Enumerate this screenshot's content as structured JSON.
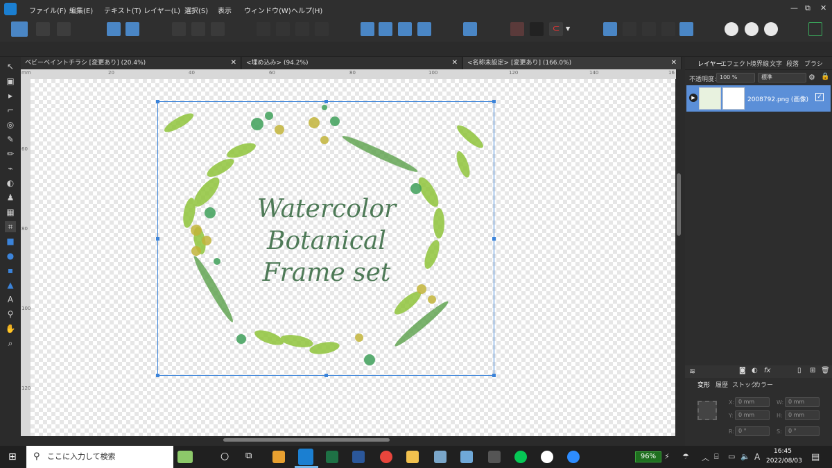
{
  "menu": {
    "items": [
      "ファイル(F)",
      "編集(E)",
      "テキスト(T)",
      "レイヤー(L)",
      "選択(S)",
      "表示",
      "ウィンドウ(W)",
      "ヘルプ(H)"
    ],
    "window_controls": [
      "—",
      "⧉",
      "✕"
    ]
  },
  "tabs": [
    {
      "label": "ベビーベイントチラシ [変更あり] (20.4%)",
      "close": "✕"
    },
    {
      "label": "<埋め込み> (94.2%)",
      "close": "✕"
    },
    {
      "label": "<名称未設定> [変更あり] (166.0%)",
      "close": "✕"
    }
  ],
  "ruler": {
    "unit": "mm",
    "h_ticks": [
      "20",
      "40",
      "60",
      "80",
      "100",
      "120",
      "140",
      "16"
    ],
    "v_ticks": [
      "60",
      "80",
      "100",
      "120"
    ]
  },
  "artwork": {
    "lines": [
      "Watercolor",
      "Botanical",
      "Frame set"
    ]
  },
  "layers_panel": {
    "tabs": [
      "レイヤー",
      "エフェクト",
      "境界線",
      "文字",
      "段落",
      "ブラシ"
    ],
    "opacity_label": "不透明度:",
    "opacity_value": "100 %",
    "blend_mode": "標準",
    "layer_name": "2008792.png (画像)"
  },
  "transform_panel": {
    "tabs": [
      "変形",
      "履歴",
      "ストック",
      "カラー"
    ],
    "x_label": "X:",
    "x_value": "0 mm",
    "y_label": "Y:",
    "y_value": "0 mm",
    "w_label": "W:",
    "w_value": "0 mm",
    "h_label": "H:",
    "h_value": "0 mm",
    "r_label": "R:",
    "r_value": "0 °",
    "s_label": "S:",
    "s_value": "0 °"
  },
  "taskbar": {
    "search_placeholder": "ここに入力して検索",
    "battery": "96%",
    "time": "16:45",
    "date": "2022/08/03",
    "ime": "A"
  },
  "colors": {
    "accent": "#3b83d9",
    "app_blue": "#1b7fd1",
    "selected_layer": "#5b8fd8",
    "text_green": "#4e7a57"
  }
}
